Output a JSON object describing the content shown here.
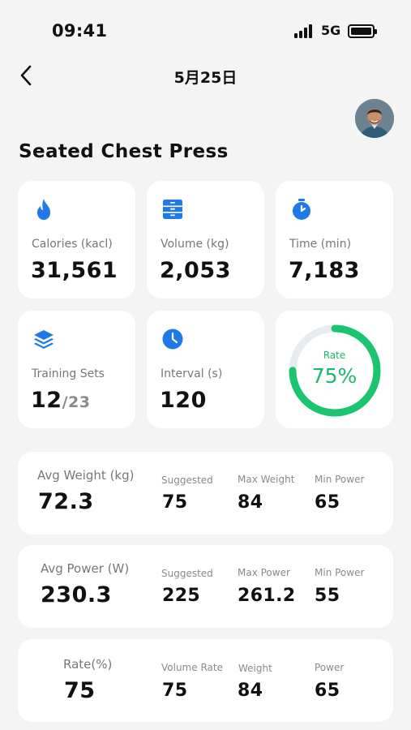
{
  "status_bar": {
    "time": "09:41",
    "network": "5G"
  },
  "nav": {
    "title": "5月25日"
  },
  "page": {
    "title": "Seated Chest Press"
  },
  "colors": {
    "accent_blue": "#1f7ae8",
    "accent_green": "#1bc46f",
    "background": "#f4f4f5"
  },
  "metrics": {
    "calories": {
      "icon": "flame-icon",
      "label": "Calories (kacl)",
      "value": "31,561"
    },
    "volume": {
      "icon": "drawer-icon",
      "label": "Volume (kg)",
      "value": "2,053"
    },
    "time": {
      "icon": "stopwatch-icon",
      "label": "Time (min)",
      "value": "7,183"
    },
    "training_sets": {
      "icon": "layers-icon",
      "label": "Training Sets",
      "value": "12",
      "total": "/23"
    },
    "interval": {
      "icon": "clock-icon",
      "label": "Interval (s)",
      "value": "120"
    },
    "rate": {
      "label": "Rate",
      "value": "75%",
      "progress": 0.75
    }
  },
  "stats": [
    {
      "main_label": "Avg Weight (kg)",
      "main_value": "72.3",
      "columns": [
        {
          "label": "Suggested",
          "value": "75"
        },
        {
          "label": "Max Weight",
          "value": "84"
        },
        {
          "label": "Min Power",
          "value": "65"
        }
      ]
    },
    {
      "main_label": "Avg Power (W)",
      "main_value": "230.3",
      "columns": [
        {
          "label": "Suggested",
          "value": "225"
        },
        {
          "label": "Max Power",
          "value": "261.2"
        },
        {
          "label": "Min Power",
          "value": "55"
        }
      ]
    },
    {
      "main_label": "Rate(%)",
      "main_value": "75",
      "columns": [
        {
          "label": "Volume Rate",
          "value": "75"
        },
        {
          "label": "Weight",
          "value": "84"
        },
        {
          "label": "Power",
          "value": "65"
        }
      ]
    }
  ]
}
